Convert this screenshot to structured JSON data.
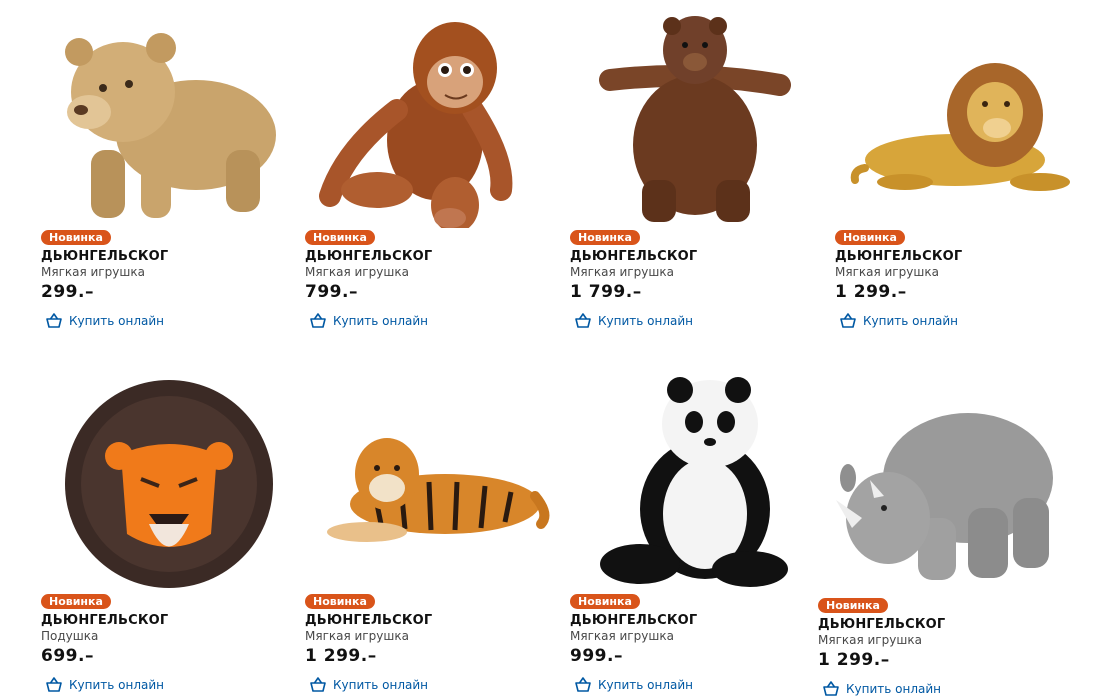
{
  "buy_label": "Купить онлайн",
  "badge_color": "#d9541a",
  "link_color": "#0058a3",
  "products": [
    {
      "badge": "Новинка",
      "name": "ДЬЮНГЕЛЬСКОГ",
      "type": "Мягкая игрушка",
      "price": "299.–",
      "image": "lion-cub-plush"
    },
    {
      "badge": "Новинка",
      "name": "ДЬЮНГЕЛЬСКОГ",
      "type": "Мягкая игрушка",
      "price": "799.–",
      "image": "orangutan-plush"
    },
    {
      "badge": "Новинка",
      "name": "ДЬЮНГЕЛЬСКОГ",
      "type": "Мягкая игрушка",
      "price": "1 799.–",
      "image": "brown-bear-plush"
    },
    {
      "badge": "Новинка",
      "name": "ДЬЮНГЕЛЬСКОГ",
      "type": "Мягкая игрушка",
      "price": "1 299.–",
      "image": "lion-plush"
    },
    {
      "badge": "Новинка",
      "name": "ДЬЮНГЕЛЬСКОГ",
      "type": "Подушка",
      "price": "699.–",
      "image": "lion-face-cushion"
    },
    {
      "badge": "Новинка",
      "name": "ДЬЮНГЕЛЬСКОГ",
      "type": "Мягкая игрушка",
      "price": "1 299.–",
      "image": "tiger-plush"
    },
    {
      "badge": "Новинка",
      "name": "ДЬЮНГЕЛЬСКОГ",
      "type": "Мягкая игрушка",
      "price": "999.–",
      "image": "panda-plush"
    },
    {
      "badge": "Новинка",
      "name": "ДЬЮНГЕЛЬСКОГ",
      "type": "Мягкая игрушка",
      "price": "1 299.–",
      "image": "rhino-plush"
    }
  ]
}
